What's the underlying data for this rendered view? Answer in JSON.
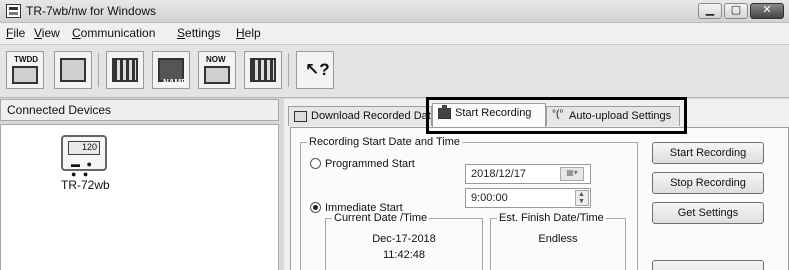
{
  "window": {
    "title": "TR-7wb/nw for Windows",
    "icons": {
      "minimize": "minimize-icon",
      "maximize": "maximize-icon",
      "close": "close-icon"
    }
  },
  "menu": [
    {
      "first": "F",
      "rest": "ile"
    },
    {
      "first": "V",
      "rest": "iew"
    },
    {
      "first": "C",
      "rest": "ommunication"
    },
    {
      "first": "S",
      "rest": "ettings"
    },
    {
      "first": "H",
      "rest": "elp"
    }
  ],
  "toolbar": {
    "icons": [
      "twdd-icon",
      "recorded-data-icon",
      "device-grid-icon",
      "device-name-icon",
      "now-icon",
      "settings-grid-icon",
      "help-icon"
    ],
    "now_label": "NOW",
    "twdd_label": "TWDD",
    "name_label": "NAME"
  },
  "left_panel": {
    "header": "Connected Devices",
    "device": {
      "name": "TR-72wb",
      "screen": "120"
    }
  },
  "tabs": [
    {
      "label": "Download Recorded Dat",
      "icon": "download-icon"
    },
    {
      "label": "Start Recording",
      "icon": "recording-icon"
    },
    {
      "label": "Auto-upload Settings",
      "icon": "signal-icon"
    }
  ],
  "recording": {
    "group_label": "Recording Start Date and Time",
    "programmed_label": "Programmed Start",
    "programmed_date": "2018/12/17",
    "programmed_time": "9:00:00",
    "immediate_label": "Immediate Start",
    "current_label": "Current Date /Time",
    "current_date": "Dec-17-2018",
    "current_time": "11:42:48",
    "finish_label": "Est. Finish Date/Time",
    "finish_value": "Endless",
    "selected": "immediate"
  },
  "buttons": {
    "start": "Start Recording",
    "stop": "Stop Recording",
    "get": "Get Settings"
  }
}
